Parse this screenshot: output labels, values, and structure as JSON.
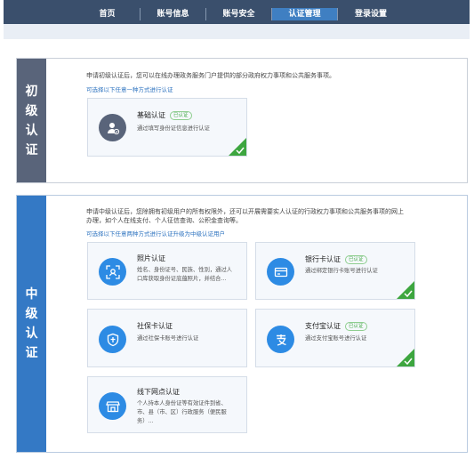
{
  "nav": {
    "items": [
      "首页",
      "账号信息",
      "账号安全",
      "认证管理",
      "登录设置"
    ]
  },
  "basic": {
    "label_chars": [
      "初",
      "级",
      "认",
      "证"
    ],
    "desc": "申请初级认证后，您可以在线办理政务服务门户提供的部分政府权力事项和公共服务事项。",
    "hint": "可选择以下任意一种方式进行认证",
    "card": {
      "title": "基础认证",
      "badge": "已认证",
      "desc": "通过填写身份证信息进行认证"
    }
  },
  "mid": {
    "label_chars": [
      "中",
      "级",
      "认",
      "证"
    ],
    "desc_line1": "申请中级认证后，您除拥有初级用户的所有权限外，还可以开展需要实人认证的行政权力事项和公共服务事项的网上",
    "desc_line2": "办理，如个人在线支付、个人征信查询、公积金查询等。",
    "hint": "可选择以下任意两种方式进行认证升级为中级认证用户",
    "cards": [
      {
        "title": "照片认证",
        "desc": "姓名、身份证号、民族、性别，通过人口库获取身份证底蕴照片，并结合..."
      },
      {
        "title": "银行卡认证",
        "badge": "已认证",
        "desc": "通过绑定银行卡账号进行认证"
      },
      {
        "title": "社保卡认证",
        "desc": "通过社保卡账号进行认证"
      },
      {
        "title": "支付宝认证",
        "badge": "已认证",
        "desc": "通过支付宝账号进行认证"
      },
      {
        "title": "线下网点认证",
        "desc": "个人持本人身份证等有效证件到省、市、县（市、区）行政服务（便民服务）..."
      }
    ]
  },
  "colors": {
    "accent": "#3479c5",
    "nav_bg": "#3a4f6c",
    "verified": "#3da63f"
  }
}
